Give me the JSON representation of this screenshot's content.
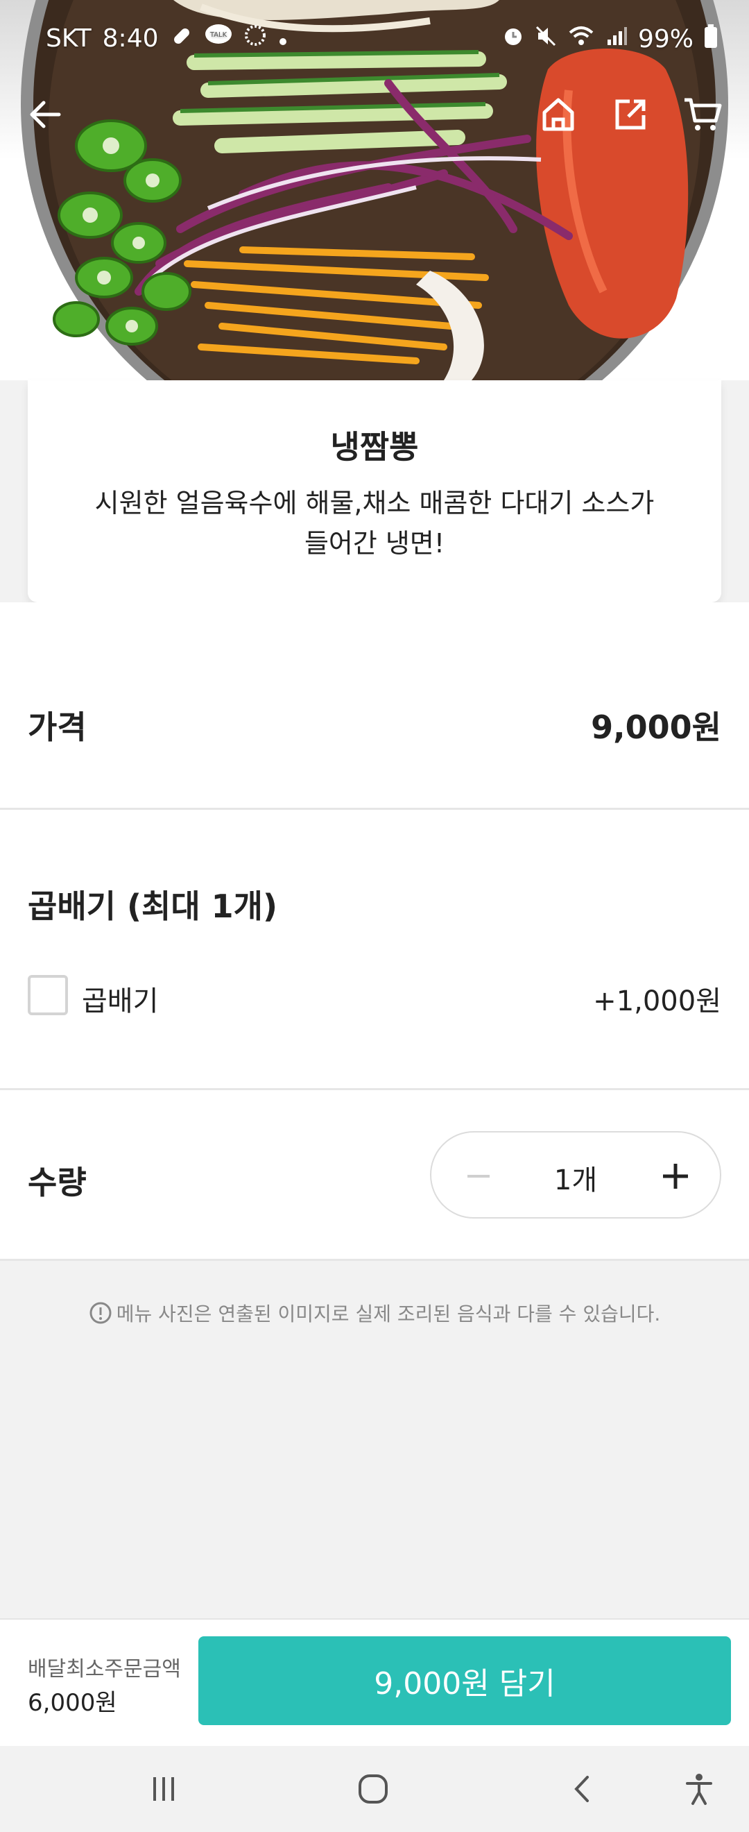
{
  "status_bar": {
    "carrier": "SKT",
    "time": "8:40",
    "battery": "99%",
    "talk_badge": "TALK"
  },
  "header": {
    "icons": [
      "back-arrow-icon",
      "home-icon",
      "share-icon",
      "cart-icon"
    ]
  },
  "menu": {
    "name": "냉짬뽕",
    "description": "시원한 얼음육수에 해물,채소 매콤한 다대기 소스가 들어간 냉면!"
  },
  "price": {
    "label": "가격",
    "value": "9,000원"
  },
  "option_group": {
    "title": "곱배기 (최대 1개)",
    "options": [
      {
        "label": "곱배기",
        "price": "+1,000원",
        "checked": false
      }
    ]
  },
  "quantity": {
    "label": "수량",
    "value": "1개"
  },
  "notice": "메뉴 사진은 연출된 이미지로 실제 조리된 음식과 다를 수 있습니다.",
  "bottom_bar": {
    "min_order_label": "배달최소주문금액",
    "min_order_value": "6,000원",
    "add_button": "9,000원 담기"
  },
  "colors": {
    "accent": "#2bc0b6",
    "text": "#222222",
    "muted": "#888888",
    "background": "#f2f2f2"
  }
}
